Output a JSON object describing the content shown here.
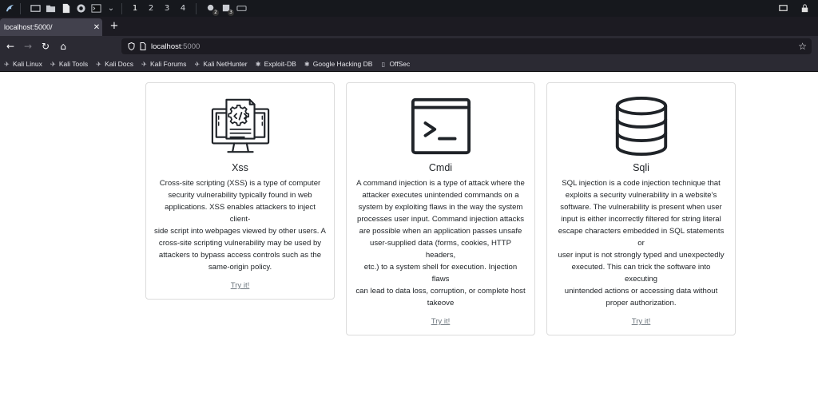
{
  "panel": {
    "workspaces": [
      "1",
      "2",
      "3",
      "4"
    ],
    "badges": [
      "2",
      "3"
    ]
  },
  "browser": {
    "tab_title": "localhost:5000/",
    "url_host": "localhost",
    "url_port": ":5000"
  },
  "bookmarks": [
    {
      "label": "Kali Linux",
      "icon": "kali-dragon-icon"
    },
    {
      "label": "Kali Tools",
      "icon": "kali-dragon-icon"
    },
    {
      "label": "Kali Docs",
      "icon": "kali-dragon-icon"
    },
    {
      "label": "Kali Forums",
      "icon": "kali-dragon-icon"
    },
    {
      "label": "Kali NetHunter",
      "icon": "kali-dragon-icon"
    },
    {
      "label": "Exploit-DB",
      "icon": "spider-icon"
    },
    {
      "label": "Google Hacking DB",
      "icon": "spider-icon"
    },
    {
      "label": "OffSec",
      "icon": "offsec-icon"
    }
  ],
  "cards": [
    {
      "title": "Xss",
      "icon": "computer-code-icon",
      "lines": [
        "Cross-site scripting (XSS) is a type of computer",
        "security vulnerability typically found in web",
        "applications. XSS enables attackers to inject client-",
        "side script into webpages viewed by other users. A",
        "cross-site scripting vulnerability may be used by",
        "attackers to bypass access controls such as the",
        "same-origin policy."
      ],
      "link": "Try it!"
    },
    {
      "title": "Cmdi",
      "icon": "terminal-icon",
      "lines": [
        "A command injection is a type of attack where the",
        "attacker executes unintended commands on a",
        "system by exploiting flaws in the way the system",
        "processes user input. Command injection attacks",
        "are possible when an application passes unsafe",
        "user-supplied data (forms, cookies, HTTP headers,",
        "etc.) to a system shell for execution. Injection flaws",
        "can lead to data loss, corruption, or complete host",
        "takeove"
      ],
      "link": "Try it!"
    },
    {
      "title": "Sqli",
      "icon": "database-icon",
      "lines": [
        "SQL injection is a code injection technique that",
        "exploits a security vulnerability in a website's",
        "software. The vulnerability is present when user",
        "input is either incorrectly filtered for string literal",
        "escape characters embedded in SQL statements or",
        "user input is not strongly typed and unexpectedly",
        "executed. This can trick the software into executing",
        "unintended actions or accessing data without",
        "proper authorization."
      ],
      "link": "Try it!"
    }
  ]
}
